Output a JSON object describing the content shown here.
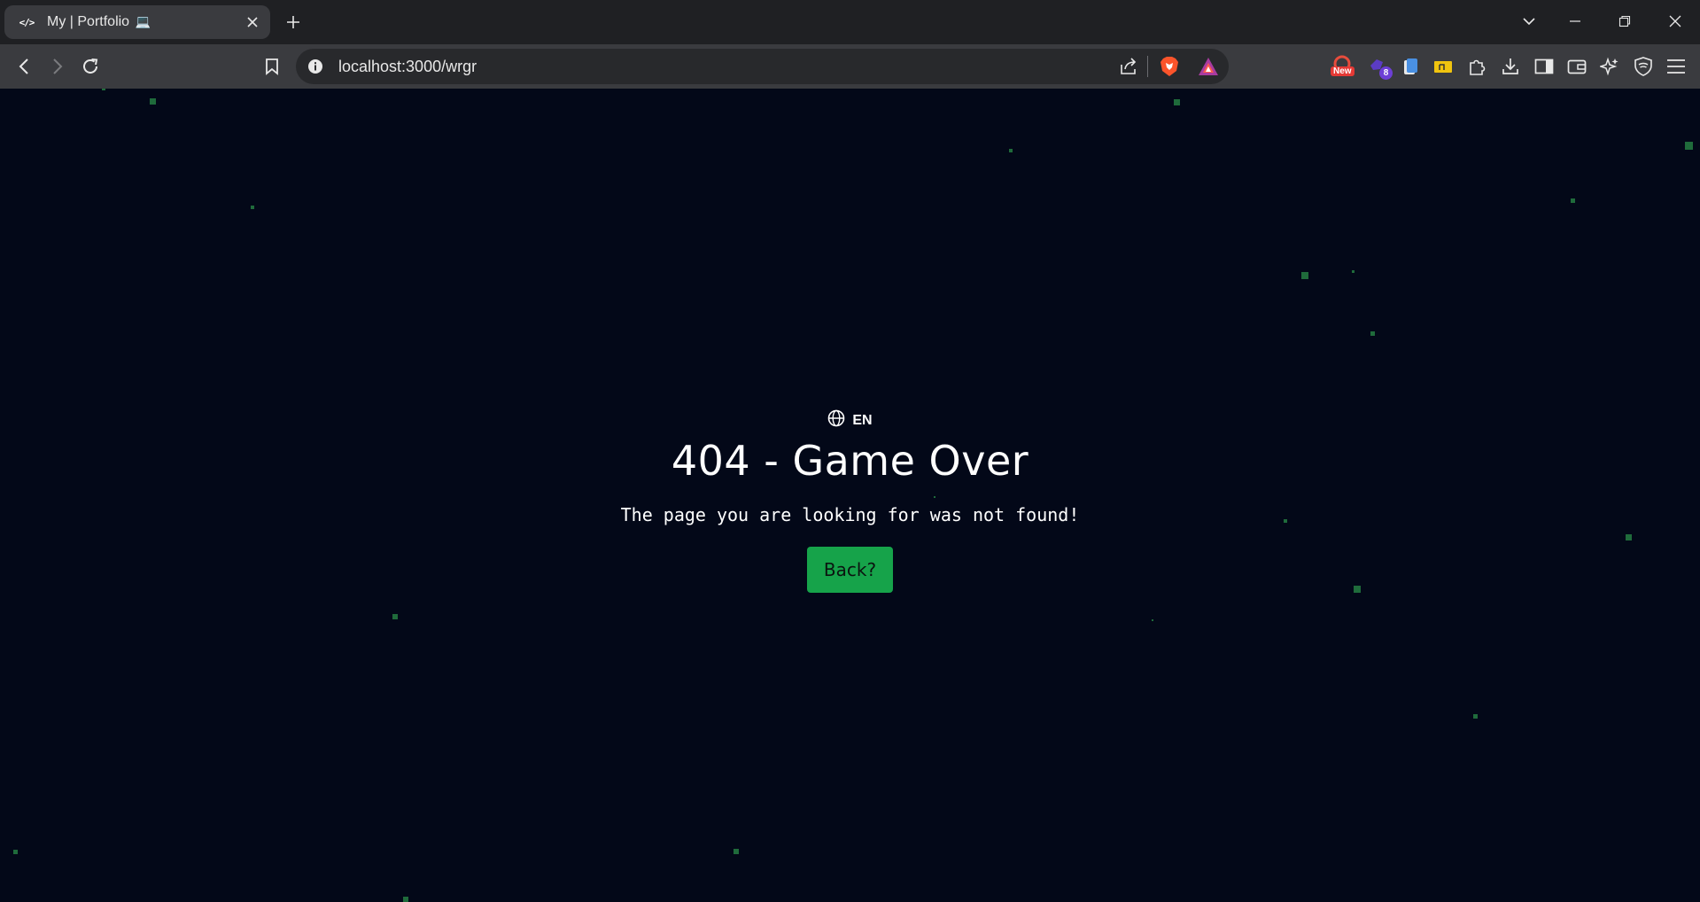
{
  "browser": {
    "tab": {
      "favicon_text": "</>",
      "title": "My | Portfolio",
      "title_emoji": "💻"
    },
    "address": {
      "url": "localhost:3000/wrgr"
    },
    "extensions": {
      "new_badge": "New",
      "count_badge": "8"
    }
  },
  "page": {
    "language": "EN",
    "title": "404 - Game Over",
    "message": "The page you are looking for was not found!",
    "back_button": "Back?"
  },
  "colors": {
    "background": "#030818",
    "accent": "#16a34a",
    "star": "#1f6b3b"
  }
}
